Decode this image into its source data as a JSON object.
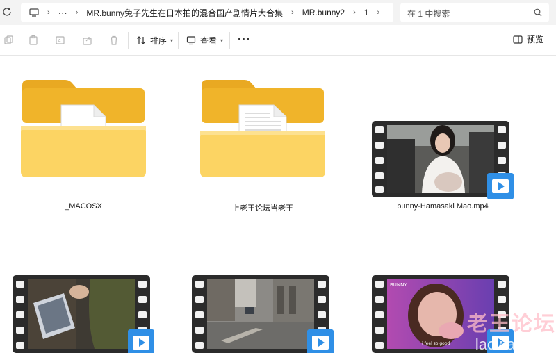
{
  "address": {
    "more": "···",
    "crumbs": [
      "MR.bunny兔子先生在日本拍的混合国产剧情片大合集",
      "MR.bunny2",
      "1"
    ]
  },
  "search": {
    "placeholder": "在 1 中搜索"
  },
  "toolbar": {
    "sort_label": "排序",
    "view_label": "查看",
    "more_label": "···",
    "preview_label": "预览"
  },
  "items": [
    {
      "name": "_MACOSX",
      "kind": "folder"
    },
    {
      "name": "上老王论坛当老王",
      "kind": "folder"
    },
    {
      "name": "bunny-Hamasaki Mao.mp4",
      "kind": "video"
    },
    {
      "name": "",
      "kind": "video"
    },
    {
      "name": "",
      "kind": "video"
    },
    {
      "name": "",
      "kind": "video"
    }
  ],
  "watermark": {
    "line1": "老王论坛",
    "line2": "laowang.vip"
  },
  "thumbnail_caption": "i feel so good",
  "thumbnail_logo": "BUNNY",
  "colors": {
    "folder": "#f7c948",
    "play_badge": "#2f8fe6",
    "film": "#2b2b2b"
  }
}
